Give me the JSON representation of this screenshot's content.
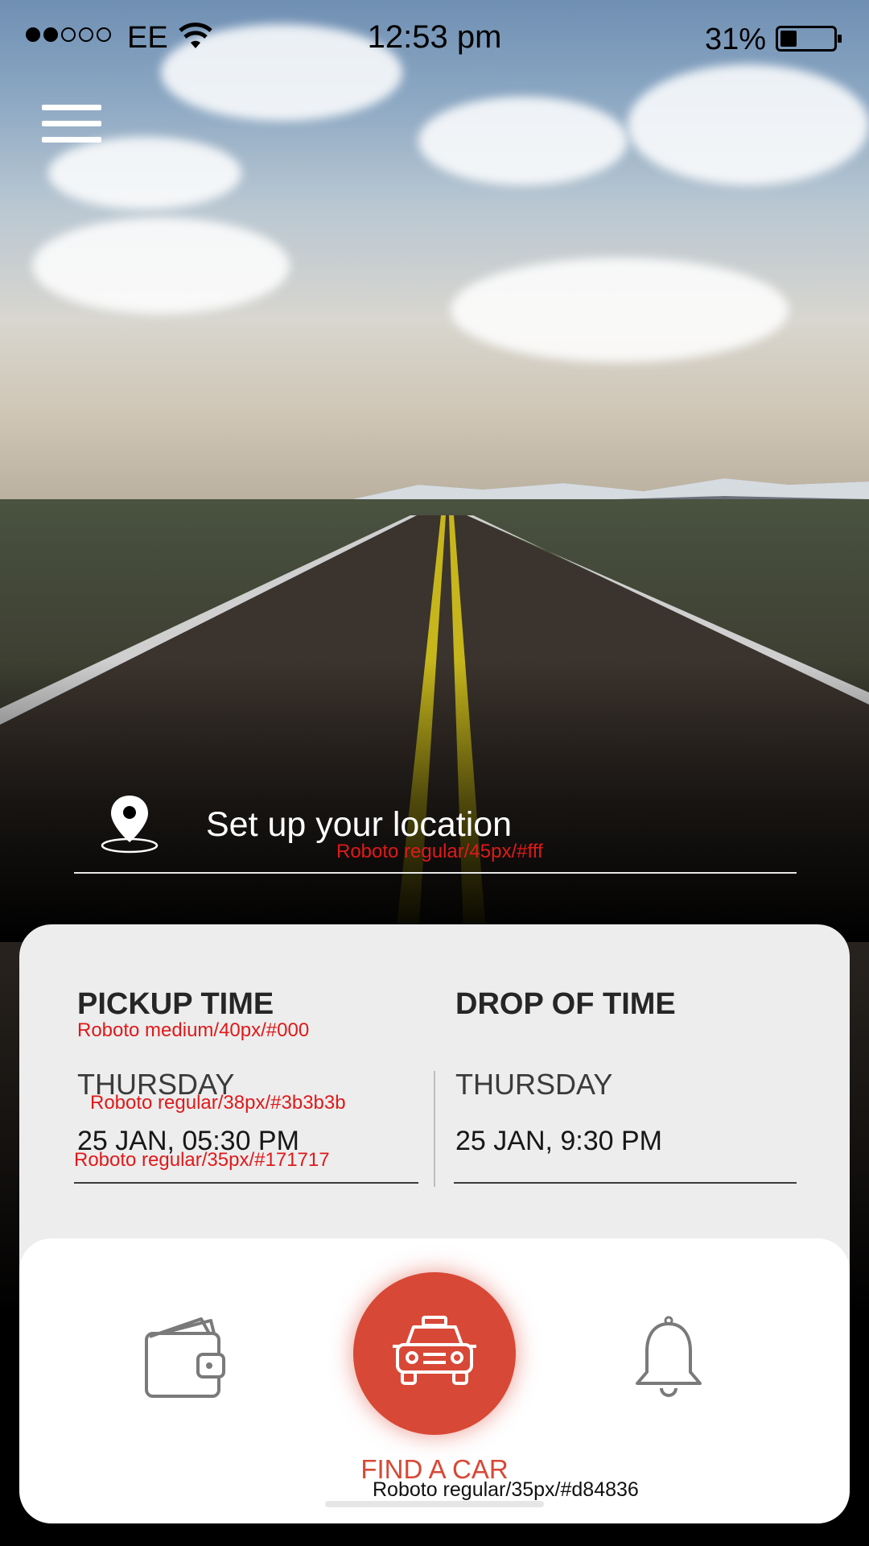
{
  "status_bar": {
    "carrier": "EE",
    "time": "12:53 pm",
    "battery_percent": "31%",
    "signal_bars_filled": 2,
    "signal_bars_total": 5,
    "battery_level": 0.31
  },
  "menu": {
    "icon": "hamburger-menu-icon"
  },
  "location": {
    "icon": "location-pin-icon",
    "text": "Set up your location",
    "spec_note": "Roboto regular/45px/#fff"
  },
  "pickup": {
    "title": "PICKUP TIME",
    "title_spec": "Roboto medium/40px/#000",
    "day": "THURSDAY",
    "day_spec": "Roboto regular/38px/#3b3b3b",
    "datetime": "25 JAN, 05:30 PM",
    "datetime_spec": "Roboto regular/35px/#171717"
  },
  "dropoff": {
    "title": "DROP OF TIME",
    "day": "THURSDAY",
    "datetime": "25 JAN, 9:30 PM"
  },
  "nav": {
    "left_icon": "wallet-icon",
    "center_icon": "car-icon",
    "right_icon": "bell-icon",
    "cta_label": "FIND A CAR",
    "cta_spec": "Roboto regular/35px/#d84836"
  },
  "colors": {
    "accent": "#d84836",
    "spec_text": "#e0191a",
    "card_bg": "#ededed",
    "nav_bg": "#ffffff"
  }
}
